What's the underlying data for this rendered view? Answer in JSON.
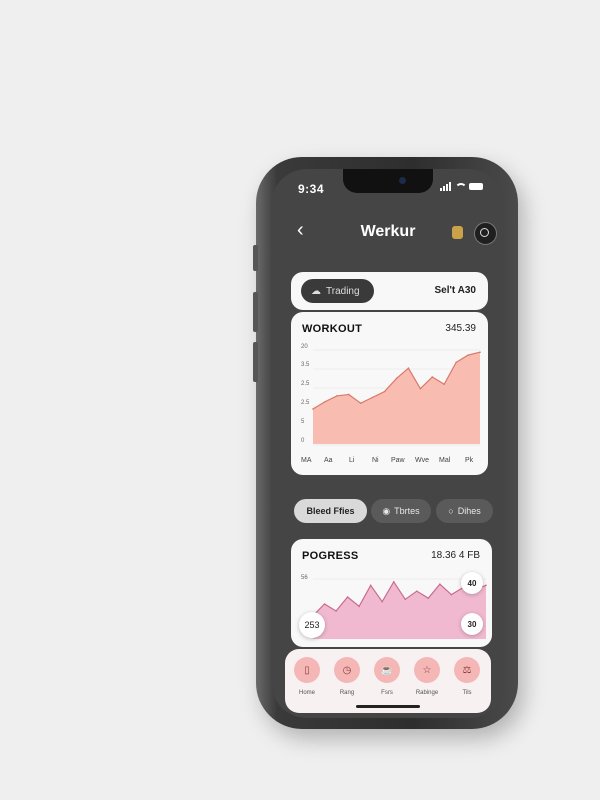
{
  "status": {
    "time": "9:34"
  },
  "nav": {
    "back_icon": "chevron-left-icon",
    "title": "Werkur"
  },
  "summary": {
    "pill_label": "Trading",
    "right_value": "Sel't A30"
  },
  "workout": {
    "title": "WORKOUT",
    "value": "345.39",
    "y_ticks": [
      "20",
      "3.5",
      "2.5",
      "2.5",
      "5",
      "0"
    ],
    "x_ticks": [
      "MA",
      "Aa",
      "Li",
      "Ni",
      "Paw",
      "Wve",
      "Mal",
      "Pk"
    ]
  },
  "chips": [
    {
      "label": "Bleed Ffies"
    },
    {
      "label": "Tbrtes"
    },
    {
      "label": "Dihes"
    }
  ],
  "progress": {
    "title": "POGRESS",
    "value": "18.36 4 FB",
    "y_tick": "56",
    "bubble_top": "40",
    "bubble_mid": "30",
    "bubble_left": "253"
  },
  "tabs": [
    {
      "label": "Home",
      "icon": "phone-icon"
    },
    {
      "label": "Rang",
      "icon": "clock-icon"
    },
    {
      "label": "Fsrs",
      "icon": "cup-icon"
    },
    {
      "label": "Rabinge",
      "icon": "star-icon"
    },
    {
      "label": "Tils",
      "icon": "flask-icon"
    }
  ],
  "chart_data": [
    {
      "type": "area",
      "title": "WORKOUT",
      "x": [
        "MA",
        "Aa",
        "Li",
        "Ni",
        "Paw",
        "Wve",
        "Mal",
        "Pk"
      ],
      "series": [
        {
          "values": [
            2.4,
            2.9,
            3.3,
            3.4,
            2.8,
            3.2,
            3.6,
            4.5,
            5.2,
            3.8,
            4.6,
            4.1,
            5.6,
            6.1,
            6.3
          ]
        }
      ],
      "colors": {
        "line": "#d9786a",
        "fill": "#f8bdb0"
      }
    },
    {
      "type": "area",
      "title": "POGRESS",
      "series": [
        {
          "values": [
            2.0,
            3.0,
            2.4,
            3.6,
            2.8,
            4.6,
            3.2,
            4.9,
            3.4,
            4.1,
            3.5,
            4.7,
            3.8,
            4.4,
            4.2,
            4.6
          ]
        }
      ],
      "colors": {
        "line": "#c96b8e",
        "fill": "#f0b9cf"
      }
    }
  ]
}
